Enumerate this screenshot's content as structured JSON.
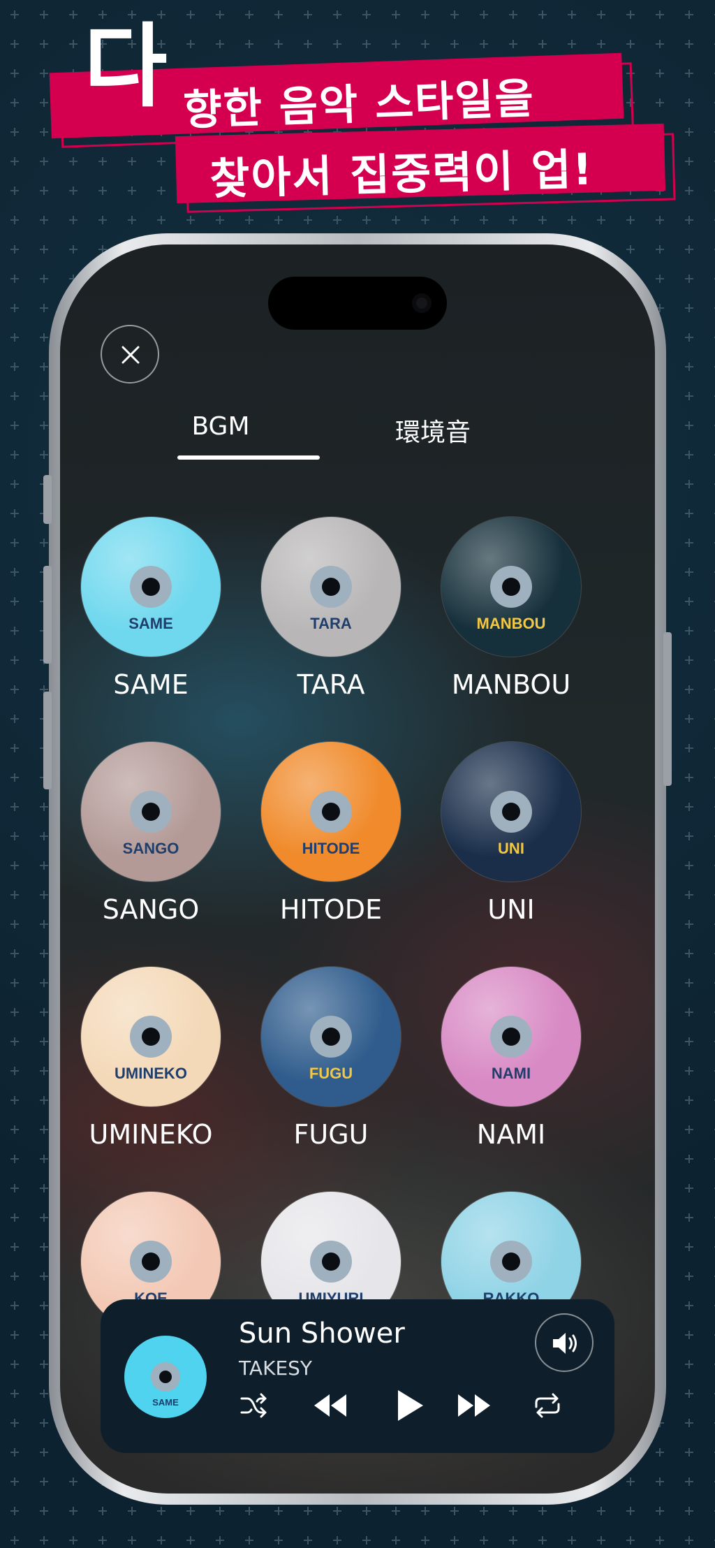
{
  "headline": {
    "big_char": "다",
    "line1": "향한 음악 스타일을",
    "line2": "찾아서 집중력이 업!"
  },
  "colors": {
    "accent": "#d4004f",
    "background": "#0d2230"
  },
  "screen": {
    "close_icon": "close-icon",
    "tabs": [
      {
        "label": "BGM",
        "selected": true
      },
      {
        "label": "環境音",
        "selected": false
      }
    ],
    "albums": [
      {
        "name": "SAME",
        "disc_text": "SAME",
        "color": "#6fd8ee"
      },
      {
        "name": "TARA",
        "disc_text": "TARA",
        "color": "#b8b6b6"
      },
      {
        "name": "MANBOU",
        "disc_text": "MANBOU",
        "color": "#16303b"
      },
      {
        "name": "SANGO",
        "disc_text": "SANGO",
        "color": "#b39a97"
      },
      {
        "name": "HITODE",
        "disc_text": "HITODE",
        "color": "#f08a2a"
      },
      {
        "name": "UNI",
        "disc_text": "UNI",
        "color": "#1a2e4a"
      },
      {
        "name": "UMINEKO",
        "disc_text": "UMINEKO",
        "color": "#f4d9b8"
      },
      {
        "name": "FUGU",
        "disc_text": "FUGU",
        "color": "#2f5c8c"
      },
      {
        "name": "NAMI",
        "disc_text": "NAMI",
        "color": "#d88ac4"
      },
      {
        "name": "",
        "disc_text": "KOE",
        "color": "#f3c9b5"
      },
      {
        "name": "",
        "disc_text": "UMIYURI",
        "color": "#e6e6ea"
      },
      {
        "name": "",
        "disc_text": "RAKKO",
        "color": "#8fd3e6"
      }
    ]
  },
  "player": {
    "title": "Sun Shower",
    "artist": "TAKESY",
    "disc_text": "SAME",
    "icons": [
      "speaker-icon",
      "shuffle-icon",
      "rewind-icon",
      "play-icon",
      "fast-forward-icon",
      "repeat-icon"
    ]
  }
}
